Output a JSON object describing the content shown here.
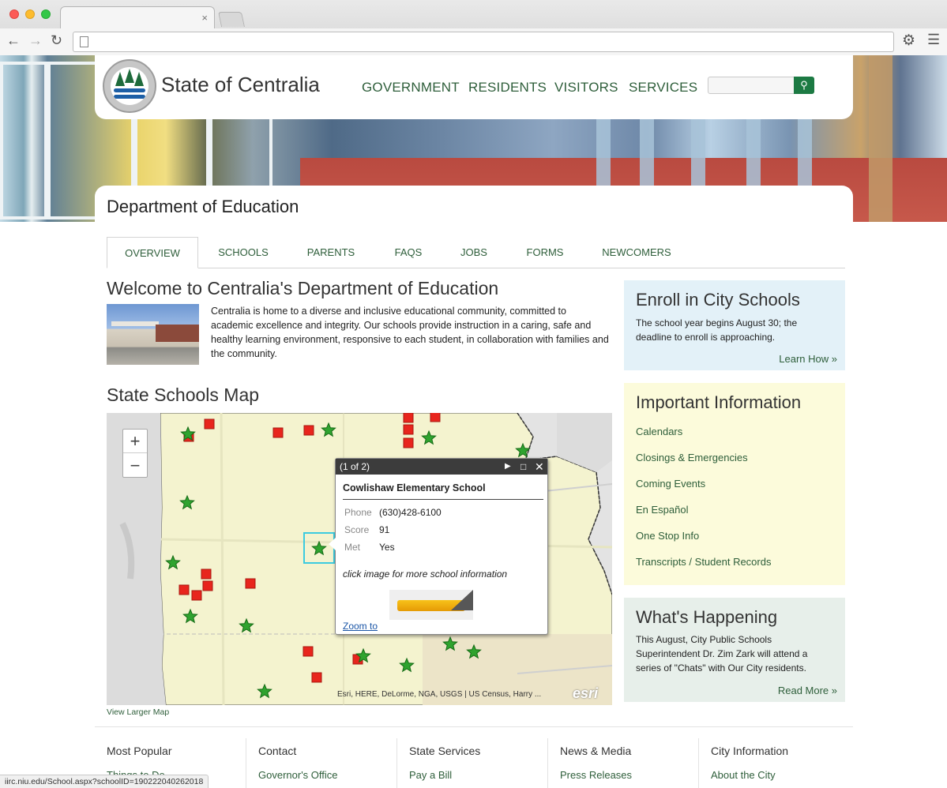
{
  "browser": {
    "tab_close": "×",
    "url": ""
  },
  "site": {
    "name": "State of Centralia",
    "nav": [
      "GOVERNMENT",
      "RESIDENTS",
      "VISITORS",
      "SERVICES"
    ],
    "search_placeholder": ""
  },
  "dept": {
    "title": "Department of Education",
    "tabs": [
      "OVERVIEW",
      "SCHOOLS",
      "PARENTS",
      "FAQS",
      "JOBS",
      "FORMS",
      "NEWCOMERS"
    ],
    "active_tab": "OVERVIEW"
  },
  "welcome": {
    "heading": "Welcome to Centralia's Department of Education",
    "body": "Centralia is home to a diverse and inclusive educational community, committed to academic excellence and integrity. Our schools provide instruction in a caring, safe and healthy learning environment, responsive to each student, in collaboration with families and the community."
  },
  "map": {
    "heading": "State Schools Map",
    "zoom_in": "+",
    "zoom_out": "−",
    "attribution": "Esri, HERE, DeLorme, NGA, USGS | US Census, Harry ...",
    "logo": "esri",
    "view_larger": "View Larger Map",
    "popup": {
      "counter": "(1 of 2)",
      "title": "Cowlishaw Elementary School",
      "fields": [
        {
          "label": "Phone",
          "value": "(630)428-6100"
        },
        {
          "label": "Score",
          "value": "91"
        },
        {
          "label": "Met",
          "value": "Yes"
        }
      ],
      "hint": "click image for more school information",
      "zoom_link": "Zoom to"
    },
    "colors": {
      "star": "#2fa32f",
      "square": "#e8251d",
      "region": "#f4f3cf"
    }
  },
  "sidebar": {
    "enroll": {
      "heading": "Enroll in City Schools",
      "body": "The school year begins August 30; the deadline to enroll is approaching.",
      "link": "Learn How »"
    },
    "info": {
      "heading": "Important Information",
      "links": [
        "Calendars",
        "Closings & Emergencies",
        "Coming Events",
        "En Español",
        "One Stop Info",
        "Transcripts / Student Records"
      ]
    },
    "happening": {
      "heading": "What's Happening",
      "body": "This August, City Public Schools Superintendent Dr. Zim Zark will attend a series of \"Chats\" with Our City residents.",
      "link": "Read More »"
    }
  },
  "footer": {
    "columns": [
      {
        "heading": "Most Popular",
        "link": "Things to Do"
      },
      {
        "heading": "Contact",
        "link": "Governor's Office"
      },
      {
        "heading": "State Services",
        "link": "Pay a Bill"
      },
      {
        "heading": "News & Media",
        "link": "Press Releases"
      },
      {
        "heading": "City Information",
        "link": "About the City"
      }
    ]
  },
  "status_bar": "iirc.niu.edu/School.aspx?schoolID=190222040262018"
}
